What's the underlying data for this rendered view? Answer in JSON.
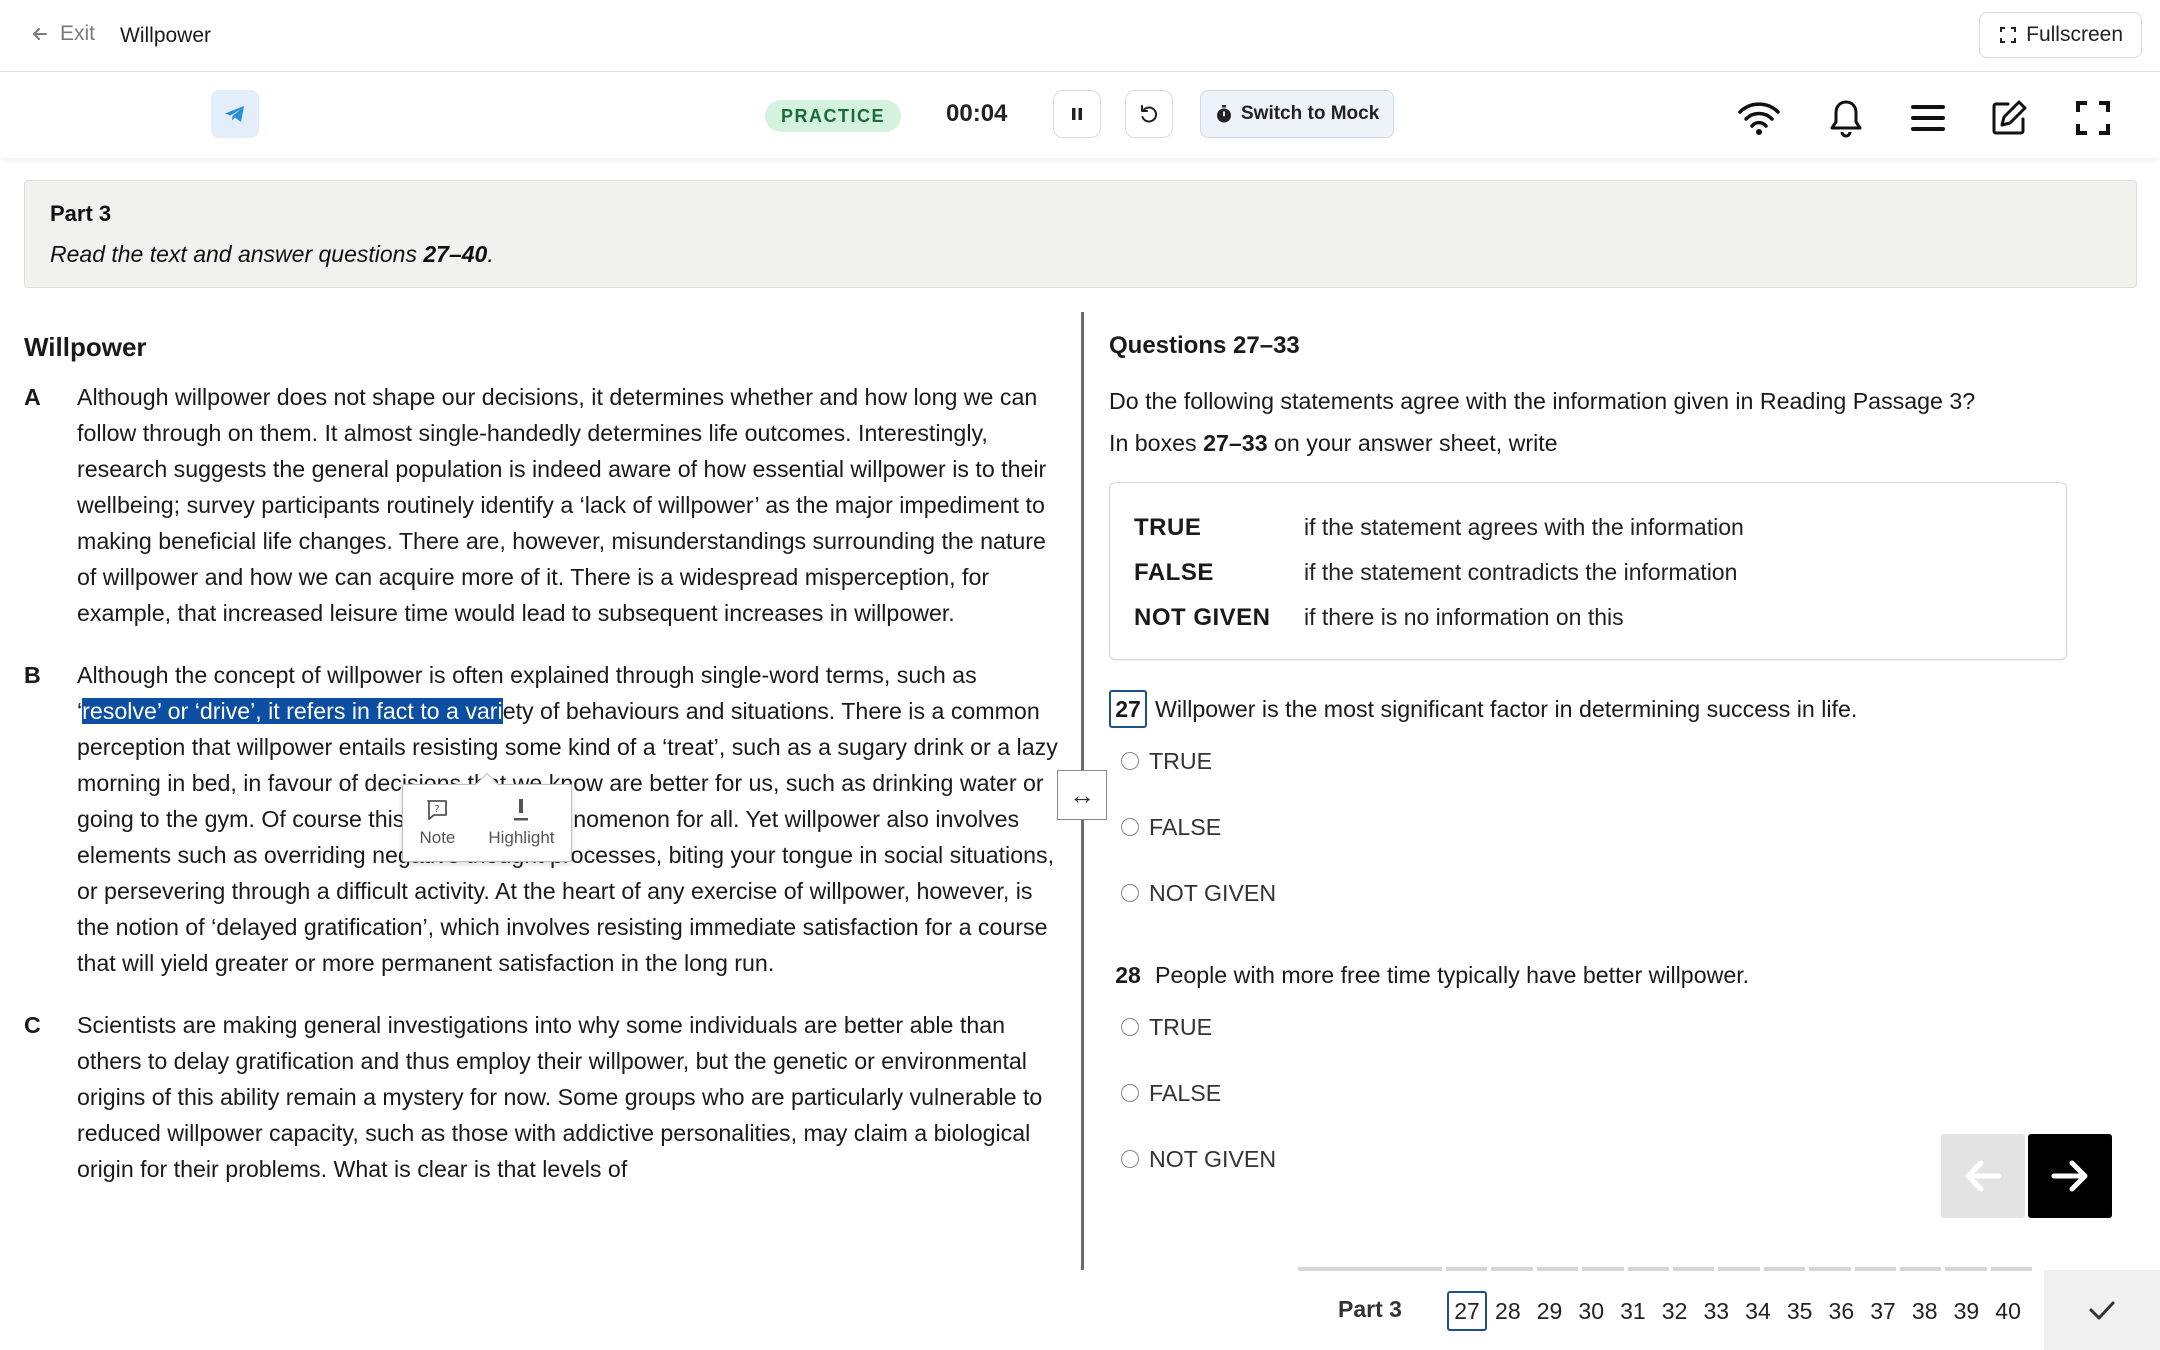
{
  "topbar": {
    "exit_label": "Exit",
    "title": "Willpower",
    "fullscreen_label": "Fullscreen"
  },
  "toolbar": {
    "mode_badge": "PRACTICE",
    "timer": "00:04",
    "switch_label": "Switch to Mock"
  },
  "part": {
    "title": "Part 3",
    "instruction_prefix": "Read the text and answer questions ",
    "instruction_range": "27–40",
    "instruction_suffix": "."
  },
  "passage": {
    "title": "Willpower",
    "paragraphs": [
      {
        "letter": "A",
        "text": "Although willpower does not shape our decisions, it determines whether and how long we can follow through on them. It almost single-handedly determines life outcomes. Interestingly, research suggests the general population is indeed aware of how essential willpower is to their wellbeing; survey participants routinely identify a ‘lack of willpower’ as the major impediment to making beneficial life changes. There are, however, misunderstandings surrounding the nature of willpower and how we can acquire more of it. There is a widespread misperception, for example, that increased leisure time would lead to subsequent increases in willpower."
      },
      {
        "letter": "B",
        "text_before": "Although the concept of willpower is often explained through single-word terms, such as ‘",
        "text_highlight": "resolve’ or ‘drive’, it refers in fact to a vari",
        "text_after": "ety of behaviours and situations. There is a common perception that willpower entails resisting some kind of a ‘treat’, such as a sugary drink or a lazy morning in bed, in favour of decisions that we know are better for us, such as drinking water or going to the gym. Of course this is a familiar phenomenon for all. Yet willpower also involves elements such as overriding negative thought processes, biting your tongue in social situations, or persevering through a difficult activity. At the heart of any exercise of willpower, however, is the notion of ‘delayed gratification’, which involves resisting immediate satisfaction for a course that will yield greater or more permanent satisfaction in the long run."
      },
      {
        "letter": "C",
        "text": "Scientists are making general investigations into why some individuals are better able than others to delay gratification and thus employ their willpower, but the genetic or environmental origins of this ability remain a mystery for now. Some groups who are particularly vulnerable to reduced willpower capacity, such as those with addictive personalities, may claim a biological origin for their problems. What is clear is that levels of"
      }
    ],
    "context_menu": {
      "note": "Note",
      "highlight": "Highlight"
    }
  },
  "questions": {
    "heading": "Questions 27–33",
    "instruction_1": "Do the following statements agree with the information given in Reading Passage 3?",
    "instruction_2_prefix": "In boxes ",
    "instruction_2_range": "27–33",
    "instruction_2_suffix": " on your answer sheet, write",
    "legend": [
      {
        "key": "TRUE",
        "desc": "if the statement agrees with the information"
      },
      {
        "key": "FALSE",
        "desc": "if the statement contradicts the information"
      },
      {
        "key": "NOT GIVEN",
        "desc": "if there is no information on this"
      }
    ],
    "items": [
      {
        "number": "27",
        "text": "Willpower is the most significant factor in determining success in life.",
        "options": [
          "TRUE",
          "FALSE",
          "NOT GIVEN"
        ]
      },
      {
        "number": "28",
        "text": "People with more free time typically have better willpower.",
        "options": [
          "TRUE",
          "FALSE",
          "NOT GIVEN"
        ]
      }
    ]
  },
  "bottom_nav": {
    "part_label": "Part 3",
    "numbers": [
      "27",
      "28",
      "29",
      "30",
      "31",
      "32",
      "33",
      "34",
      "35",
      "36",
      "37",
      "38",
      "39",
      "40"
    ],
    "current": "27"
  },
  "icons": {
    "exit": "arrow-left-icon",
    "fullscreen": "fullscreen-icon",
    "telegram": "telegram-icon",
    "pause": "pause-icon",
    "reset": "reset-icon",
    "stopwatch": "stopwatch-icon",
    "wifi": "wifi-icon",
    "bell": "bell-icon",
    "menu": "menu-icon",
    "edit": "edit-icon",
    "expand": "expand-icon",
    "note": "note-icon",
    "highlight": "highlight-icon",
    "resize": "resize-icon",
    "prev": "arrow-left-icon",
    "next": "arrow-right-icon",
    "submit": "checkmark-icon"
  },
  "colors": {
    "accent": "#1d4f8a",
    "highlight": "#0b4ea2",
    "practice_bg": "#d4f3df",
    "practice_text": "#1c6a3b",
    "telegram": "#2a8fd6"
  }
}
